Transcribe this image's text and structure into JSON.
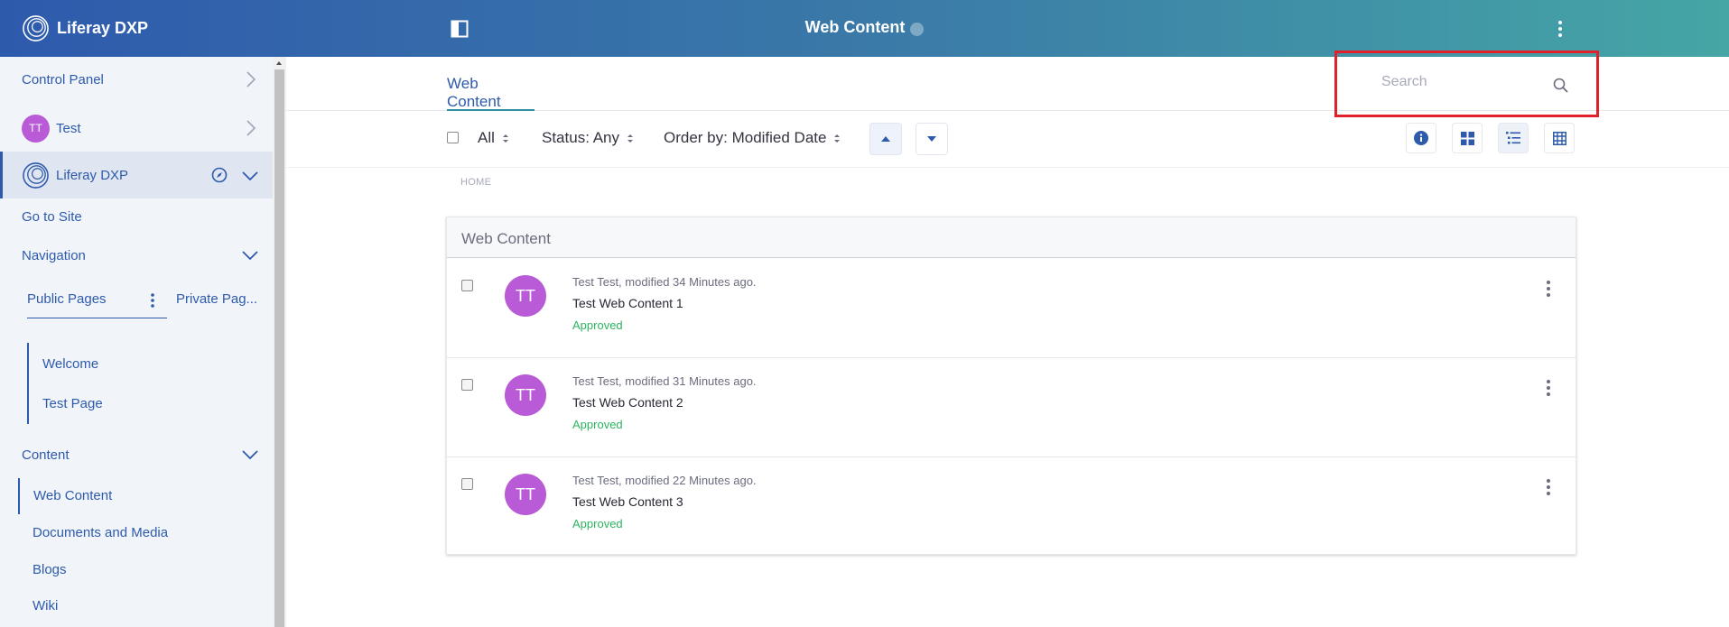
{
  "header": {
    "brand": "Liferay DXP",
    "title": "Web Content",
    "help_glyph": "?"
  },
  "sidebar": {
    "control_panel": "Control Panel",
    "user": {
      "initials": "TT",
      "name": "Test"
    },
    "site": {
      "name": "Liferay DXP"
    },
    "go_to_site": "Go to Site",
    "navigation": "Navigation",
    "tabs": {
      "public": "Public Pages",
      "private": "Private Pag..."
    },
    "pages": [
      "Welcome",
      "Test Page"
    ],
    "content": "Content",
    "content_items": [
      "Web Content",
      "Documents and Media",
      "Blogs",
      "Wiki"
    ]
  },
  "tabbar": {
    "active_tab": "Web Content",
    "search": {
      "placeholder": "Search",
      "value": ""
    }
  },
  "toolbar": {
    "filter_all": "All",
    "status": "Status: Any",
    "order_by": "Order by: Modified Date"
  },
  "breadcrumb": "HOME",
  "list": {
    "header": "Web Content",
    "rows": [
      {
        "initials": "TT",
        "meta": "Test Test, modified 34 Minutes ago.",
        "title": "Test Web Content 1",
        "status": "Approved"
      },
      {
        "initials": "TT",
        "meta": "Test Test, modified 31 Minutes ago.",
        "title": "Test Web Content 2",
        "status": "Approved"
      },
      {
        "initials": "TT",
        "meta": "Test Test, modified 22 Minutes ago.",
        "title": "Test Web Content 3",
        "status": "Approved"
      }
    ]
  },
  "colors": {
    "primary": "#2e5aac",
    "approved": "#2bb55f",
    "avatar": "#b95ad6",
    "highlight": "#e0202a"
  }
}
